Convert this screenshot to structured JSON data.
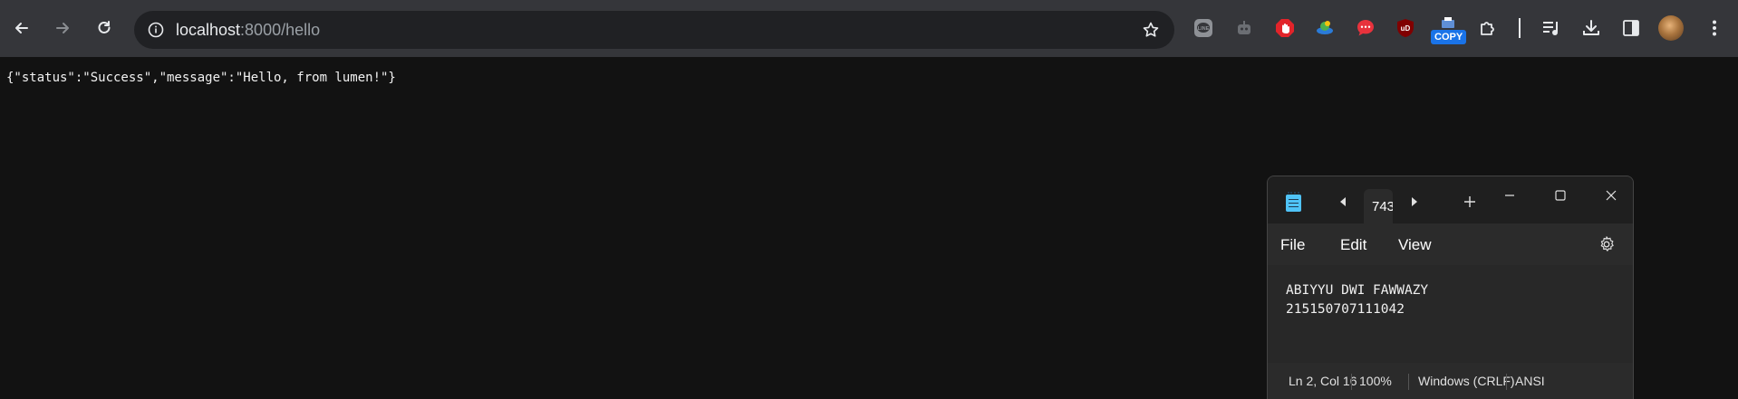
{
  "browser": {
    "url_host": "localhost",
    "url_path": ":8000/hello",
    "copy_badge": "COPY",
    "extensions": [
      "line-icon",
      "robot-icon",
      "stop-hand-icon",
      "photo-icon",
      "chat-bubble-icon",
      "ublock-icon",
      "copy-extension-icon",
      "puzzle-icon"
    ]
  },
  "page": {
    "json_text": "{\"status\":\"Success\",\"message\":\"Hello, from lumen!\"}"
  },
  "notepad": {
    "tab_label": "743",
    "menu": {
      "file": "File",
      "edit": "Edit",
      "view": "View"
    },
    "content_line1": "ABIYYU DWI FAWWAZY",
    "content_line2": "215150707111042",
    "status": {
      "position": "Ln 2, Col 16",
      "zoom": "100%",
      "line_ending": "Windows (CRLF)",
      "encoding": "ANSI"
    }
  },
  "colors": {
    "toolbar": "#35363a",
    "omnibox": "#202124",
    "page_bg": "#121212",
    "accent_blue": "#1a73e8"
  }
}
